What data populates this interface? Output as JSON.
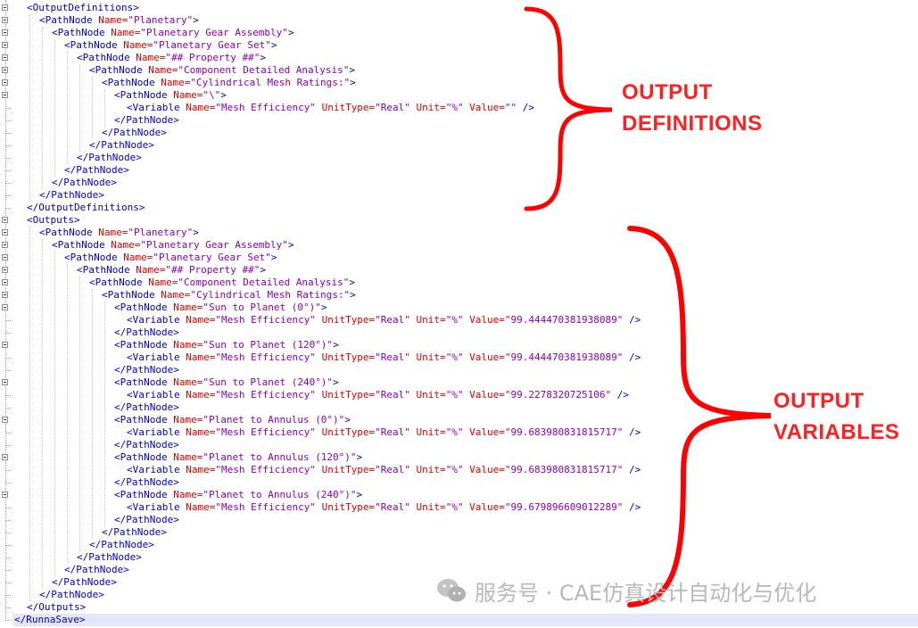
{
  "xml": {
    "lines": [
      [
        {
          "t": "p",
          "s": "<"
        },
        {
          "t": "tag",
          "s": "OutputDefinitions"
        },
        {
          "t": "p",
          "s": ">"
        }
      ],
      [
        {
          "t": "p",
          "s": "<"
        },
        {
          "t": "tag",
          "s": "PathNode"
        },
        {
          "t": "attr",
          "s": " Name="
        },
        {
          "t": "val",
          "s": "\"Planetary\""
        },
        {
          "t": "p",
          "s": ">"
        }
      ],
      [
        {
          "t": "p",
          "s": "<"
        },
        {
          "t": "tag",
          "s": "PathNode"
        },
        {
          "t": "attr",
          "s": " Name="
        },
        {
          "t": "val",
          "s": "\"Planetary Gear Assembly\""
        },
        {
          "t": "p",
          "s": ">"
        }
      ],
      [
        {
          "t": "p",
          "s": "<"
        },
        {
          "t": "tag",
          "s": "PathNode"
        },
        {
          "t": "attr",
          "s": " Name="
        },
        {
          "t": "val",
          "s": "\"Planetary Gear Set\""
        },
        {
          "t": "p",
          "s": ">"
        }
      ],
      [
        {
          "t": "p",
          "s": "<"
        },
        {
          "t": "tag",
          "s": "PathNode"
        },
        {
          "t": "attr",
          "s": " Name="
        },
        {
          "t": "val",
          "s": "\"## Property ##\""
        },
        {
          "t": "p",
          "s": ">"
        }
      ],
      [
        {
          "t": "p",
          "s": "<"
        },
        {
          "t": "tag",
          "s": "PathNode"
        },
        {
          "t": "attr",
          "s": " Name="
        },
        {
          "t": "val",
          "s": "\"Component Detailed Analysis\""
        },
        {
          "t": "p",
          "s": ">"
        }
      ],
      [
        {
          "t": "p",
          "s": "<"
        },
        {
          "t": "tag",
          "s": "PathNode"
        },
        {
          "t": "attr",
          "s": " Name="
        },
        {
          "t": "val",
          "s": "\"Cylindrical Mesh Ratings:\""
        },
        {
          "t": "p",
          "s": ">"
        }
      ],
      [
        {
          "t": "p",
          "s": "<"
        },
        {
          "t": "tag",
          "s": "PathNode"
        },
        {
          "t": "attr",
          "s": " Name="
        },
        {
          "t": "val",
          "s": "\"\\\""
        },
        {
          "t": "p",
          "s": ">"
        }
      ],
      [
        {
          "t": "p",
          "s": "<"
        },
        {
          "t": "tag",
          "s": "Variable"
        },
        {
          "t": "attr",
          "s": " Name="
        },
        {
          "t": "val",
          "s": "\"Mesh Efficiency\""
        },
        {
          "t": "attr",
          "s": " UnitType="
        },
        {
          "t": "val",
          "s": "\"Real\""
        },
        {
          "t": "attr",
          "s": " Unit="
        },
        {
          "t": "val",
          "s": "\"%\""
        },
        {
          "t": "attr",
          "s": " Value="
        },
        {
          "t": "val",
          "s": "\"\""
        },
        {
          "t": "p",
          "s": " />"
        }
      ],
      [
        {
          "t": "p",
          "s": "</"
        },
        {
          "t": "tag",
          "s": "PathNode"
        },
        {
          "t": "p",
          "s": ">"
        }
      ],
      [
        {
          "t": "p",
          "s": "</"
        },
        {
          "t": "tag",
          "s": "PathNode"
        },
        {
          "t": "p",
          "s": ">"
        }
      ],
      [
        {
          "t": "p",
          "s": "</"
        },
        {
          "t": "tag",
          "s": "PathNode"
        },
        {
          "t": "p",
          "s": ">"
        }
      ],
      [
        {
          "t": "p",
          "s": "</"
        },
        {
          "t": "tag",
          "s": "PathNode"
        },
        {
          "t": "p",
          "s": ">"
        }
      ],
      [
        {
          "t": "p",
          "s": "</"
        },
        {
          "t": "tag",
          "s": "PathNode"
        },
        {
          "t": "p",
          "s": ">"
        }
      ],
      [
        {
          "t": "p",
          "s": "</"
        },
        {
          "t": "tag",
          "s": "PathNode"
        },
        {
          "t": "p",
          "s": ">"
        }
      ],
      [
        {
          "t": "p",
          "s": "</"
        },
        {
          "t": "tag",
          "s": "PathNode"
        },
        {
          "t": "p",
          "s": ">"
        }
      ],
      [
        {
          "t": "p",
          "s": "</"
        },
        {
          "t": "tag",
          "s": "OutputDefinitions"
        },
        {
          "t": "p",
          "s": ">"
        }
      ],
      [
        {
          "t": "p",
          "s": "<"
        },
        {
          "t": "tag",
          "s": "Outputs"
        },
        {
          "t": "p",
          "s": ">"
        }
      ],
      [
        {
          "t": "p",
          "s": "<"
        },
        {
          "t": "tag",
          "s": "PathNode"
        },
        {
          "t": "attr",
          "s": " Name="
        },
        {
          "t": "val",
          "s": "\"Planetary\""
        },
        {
          "t": "p",
          "s": ">"
        }
      ],
      [
        {
          "t": "p",
          "s": "<"
        },
        {
          "t": "tag",
          "s": "PathNode"
        },
        {
          "t": "attr",
          "s": " Name="
        },
        {
          "t": "val",
          "s": "\"Planetary Gear Assembly\""
        },
        {
          "t": "p",
          "s": ">"
        }
      ],
      [
        {
          "t": "p",
          "s": "<"
        },
        {
          "t": "tag",
          "s": "PathNode"
        },
        {
          "t": "attr",
          "s": " Name="
        },
        {
          "t": "val",
          "s": "\"Planetary Gear Set\""
        },
        {
          "t": "p",
          "s": ">"
        }
      ],
      [
        {
          "t": "p",
          "s": "<"
        },
        {
          "t": "tag",
          "s": "PathNode"
        },
        {
          "t": "attr",
          "s": " Name="
        },
        {
          "t": "val",
          "s": "\"## Property ##\""
        },
        {
          "t": "p",
          "s": ">"
        }
      ],
      [
        {
          "t": "p",
          "s": "<"
        },
        {
          "t": "tag",
          "s": "PathNode"
        },
        {
          "t": "attr",
          "s": " Name="
        },
        {
          "t": "val",
          "s": "\"Component Detailed Analysis\""
        },
        {
          "t": "p",
          "s": ">"
        }
      ],
      [
        {
          "t": "p",
          "s": "<"
        },
        {
          "t": "tag",
          "s": "PathNode"
        },
        {
          "t": "attr",
          "s": " Name="
        },
        {
          "t": "val",
          "s": "\"Cylindrical Mesh Ratings:\""
        },
        {
          "t": "p",
          "s": ">"
        }
      ],
      [
        {
          "t": "p",
          "s": "<"
        },
        {
          "t": "tag",
          "s": "PathNode"
        },
        {
          "t": "attr",
          "s": " Name="
        },
        {
          "t": "val",
          "s": "\"Sun to Planet (0°)\""
        },
        {
          "t": "p",
          "s": ">"
        }
      ],
      [
        {
          "t": "p",
          "s": "<"
        },
        {
          "t": "tag",
          "s": "Variable"
        },
        {
          "t": "attr",
          "s": " Name="
        },
        {
          "t": "val",
          "s": "\"Mesh Efficiency\""
        },
        {
          "t": "attr",
          "s": " UnitType="
        },
        {
          "t": "val",
          "s": "\"Real\""
        },
        {
          "t": "attr",
          "s": " Unit="
        },
        {
          "t": "val",
          "s": "\"%\""
        },
        {
          "t": "attr",
          "s": " Value="
        },
        {
          "t": "val",
          "s": "\"99.444470381938089\""
        },
        {
          "t": "p",
          "s": " />"
        }
      ],
      [
        {
          "t": "p",
          "s": "</"
        },
        {
          "t": "tag",
          "s": "PathNode"
        },
        {
          "t": "p",
          "s": ">"
        }
      ],
      [
        {
          "t": "p",
          "s": "<"
        },
        {
          "t": "tag",
          "s": "PathNode"
        },
        {
          "t": "attr",
          "s": " Name="
        },
        {
          "t": "val",
          "s": "\"Sun to Planet (120°)\""
        },
        {
          "t": "p",
          "s": ">"
        }
      ],
      [
        {
          "t": "p",
          "s": "<"
        },
        {
          "t": "tag",
          "s": "Variable"
        },
        {
          "t": "attr",
          "s": " Name="
        },
        {
          "t": "val",
          "s": "\"Mesh Efficiency\""
        },
        {
          "t": "attr",
          "s": " UnitType="
        },
        {
          "t": "val",
          "s": "\"Real\""
        },
        {
          "t": "attr",
          "s": " Unit="
        },
        {
          "t": "val",
          "s": "\"%\""
        },
        {
          "t": "attr",
          "s": " Value="
        },
        {
          "t": "val",
          "s": "\"99.444470381938089\""
        },
        {
          "t": "p",
          "s": " />"
        }
      ],
      [
        {
          "t": "p",
          "s": "</"
        },
        {
          "t": "tag",
          "s": "PathNode"
        },
        {
          "t": "p",
          "s": ">"
        }
      ],
      [
        {
          "t": "p",
          "s": "<"
        },
        {
          "t": "tag",
          "s": "PathNode"
        },
        {
          "t": "attr",
          "s": " Name="
        },
        {
          "t": "val",
          "s": "\"Sun to Planet (240°)\""
        },
        {
          "t": "p",
          "s": ">"
        }
      ],
      [
        {
          "t": "p",
          "s": "<"
        },
        {
          "t": "tag",
          "s": "Variable"
        },
        {
          "t": "attr",
          "s": " Name="
        },
        {
          "t": "val",
          "s": "\"Mesh Efficiency\""
        },
        {
          "t": "attr",
          "s": " UnitType="
        },
        {
          "t": "val",
          "s": "\"Real\""
        },
        {
          "t": "attr",
          "s": " Unit="
        },
        {
          "t": "val",
          "s": "\"%\""
        },
        {
          "t": "attr",
          "s": " Value="
        },
        {
          "t": "val",
          "s": "\"99.2278320725106\""
        },
        {
          "t": "p",
          "s": " />"
        }
      ],
      [
        {
          "t": "p",
          "s": "</"
        },
        {
          "t": "tag",
          "s": "PathNode"
        },
        {
          "t": "p",
          "s": ">"
        }
      ],
      [
        {
          "t": "p",
          "s": "<"
        },
        {
          "t": "tag",
          "s": "PathNode"
        },
        {
          "t": "attr",
          "s": " Name="
        },
        {
          "t": "val",
          "s": "\"Planet to Annulus (0°)\""
        },
        {
          "t": "p",
          "s": ">"
        }
      ],
      [
        {
          "t": "p",
          "s": "<"
        },
        {
          "t": "tag",
          "s": "Variable"
        },
        {
          "t": "attr",
          "s": " Name="
        },
        {
          "t": "val",
          "s": "\"Mesh Efficiency\""
        },
        {
          "t": "attr",
          "s": " UnitType="
        },
        {
          "t": "val",
          "s": "\"Real\""
        },
        {
          "t": "attr",
          "s": " Unit="
        },
        {
          "t": "val",
          "s": "\"%\""
        },
        {
          "t": "attr",
          "s": " Value="
        },
        {
          "t": "val",
          "s": "\"99.683980831815717\""
        },
        {
          "t": "p",
          "s": " />"
        }
      ],
      [
        {
          "t": "p",
          "s": "</"
        },
        {
          "t": "tag",
          "s": "PathNode"
        },
        {
          "t": "p",
          "s": ">"
        }
      ],
      [
        {
          "t": "p",
          "s": "<"
        },
        {
          "t": "tag",
          "s": "PathNode"
        },
        {
          "t": "attr",
          "s": " Name="
        },
        {
          "t": "val",
          "s": "\"Planet to Annulus (120°)\""
        },
        {
          "t": "p",
          "s": ">"
        }
      ],
      [
        {
          "t": "p",
          "s": "<"
        },
        {
          "t": "tag",
          "s": "Variable"
        },
        {
          "t": "attr",
          "s": " Name="
        },
        {
          "t": "val",
          "s": "\"Mesh Efficiency\""
        },
        {
          "t": "attr",
          "s": " UnitType="
        },
        {
          "t": "val",
          "s": "\"Real\""
        },
        {
          "t": "attr",
          "s": " Unit="
        },
        {
          "t": "val",
          "s": "\"%\""
        },
        {
          "t": "attr",
          "s": " Value="
        },
        {
          "t": "val",
          "s": "\"99.683980831815717\""
        },
        {
          "t": "p",
          "s": " />"
        }
      ],
      [
        {
          "t": "p",
          "s": "</"
        },
        {
          "t": "tag",
          "s": "PathNode"
        },
        {
          "t": "p",
          "s": ">"
        }
      ],
      [
        {
          "t": "p",
          "s": "<"
        },
        {
          "t": "tag",
          "s": "PathNode"
        },
        {
          "t": "attr",
          "s": " Name="
        },
        {
          "t": "val",
          "s": "\"Planet to Annulus (240°)\""
        },
        {
          "t": "p",
          "s": ">"
        }
      ],
      [
        {
          "t": "p",
          "s": "<"
        },
        {
          "t": "tag",
          "s": "Variable"
        },
        {
          "t": "attr",
          "s": " Name="
        },
        {
          "t": "val",
          "s": "\"Mesh Efficiency\""
        },
        {
          "t": "attr",
          "s": " UnitType="
        },
        {
          "t": "val",
          "s": "\"Real\""
        },
        {
          "t": "attr",
          "s": " Unit="
        },
        {
          "t": "val",
          "s": "\"%\""
        },
        {
          "t": "attr",
          "s": " Value="
        },
        {
          "t": "val",
          "s": "\"99.679896609012289\""
        },
        {
          "t": "p",
          "s": " />"
        }
      ],
      [
        {
          "t": "p",
          "s": "</"
        },
        {
          "t": "tag",
          "s": "PathNode"
        },
        {
          "t": "p",
          "s": ">"
        }
      ],
      [
        {
          "t": "p",
          "s": "</"
        },
        {
          "t": "tag",
          "s": "PathNode"
        },
        {
          "t": "p",
          "s": ">"
        }
      ],
      [
        {
          "t": "p",
          "s": "</"
        },
        {
          "t": "tag",
          "s": "PathNode"
        },
        {
          "t": "p",
          "s": ">"
        }
      ],
      [
        {
          "t": "p",
          "s": "</"
        },
        {
          "t": "tag",
          "s": "PathNode"
        },
        {
          "t": "p",
          "s": ">"
        }
      ],
      [
        {
          "t": "p",
          "s": "</"
        },
        {
          "t": "tag",
          "s": "PathNode"
        },
        {
          "t": "p",
          "s": ">"
        }
      ],
      [
        {
          "t": "p",
          "s": "</"
        },
        {
          "t": "tag",
          "s": "PathNode"
        },
        {
          "t": "p",
          "s": ">"
        }
      ],
      [
        {
          "t": "p",
          "s": "</"
        },
        {
          "t": "tag",
          "s": "PathNode"
        },
        {
          "t": "p",
          "s": ">"
        }
      ],
      [
        {
          "t": "p",
          "s": "</"
        },
        {
          "t": "tag",
          "s": "Outputs"
        },
        {
          "t": "p",
          "s": ">"
        }
      ],
      [
        {
          "t": "p",
          "s": "</"
        },
        {
          "t": "tag",
          "s": "RunnaSave"
        },
        {
          "t": "p",
          "s": ">"
        }
      ]
    ],
    "depth": [
      1,
      2,
      3,
      4,
      5,
      6,
      7,
      8,
      9,
      8,
      7,
      6,
      5,
      4,
      3,
      2,
      1,
      1,
      2,
      3,
      4,
      5,
      6,
      7,
      8,
      9,
      8,
      8,
      9,
      8,
      8,
      9,
      8,
      8,
      9,
      8,
      8,
      9,
      8,
      8,
      9,
      8,
      7,
      6,
      5,
      4,
      3,
      2,
      1,
      0
    ],
    "foldable": [
      true,
      true,
      true,
      true,
      true,
      true,
      true,
      true,
      false,
      false,
      false,
      false,
      false,
      false,
      false,
      false,
      false,
      true,
      true,
      true,
      true,
      true,
      true,
      true,
      true,
      false,
      false,
      true,
      false,
      false,
      true,
      false,
      false,
      true,
      false,
      false,
      true,
      false,
      false,
      true,
      false,
      false,
      false,
      false,
      false,
      false,
      false,
      false,
      false,
      false
    ]
  },
  "annotations": {
    "definitions_line1": "OUTPUT",
    "definitions_line2": "DEFINITIONS",
    "variables_line1": "OUTPUT",
    "variables_line2": "VARIABLES",
    "color": "#ff2020"
  },
  "watermark": {
    "text": "服务号 · CAE仿真设计自动化与优化",
    "icon": "wechat-icon"
  },
  "colors": {
    "tag": "#0000c8",
    "attribute": "#e00000",
    "value": "#8b00b8",
    "highlight_line": "#e6e6fa"
  }
}
